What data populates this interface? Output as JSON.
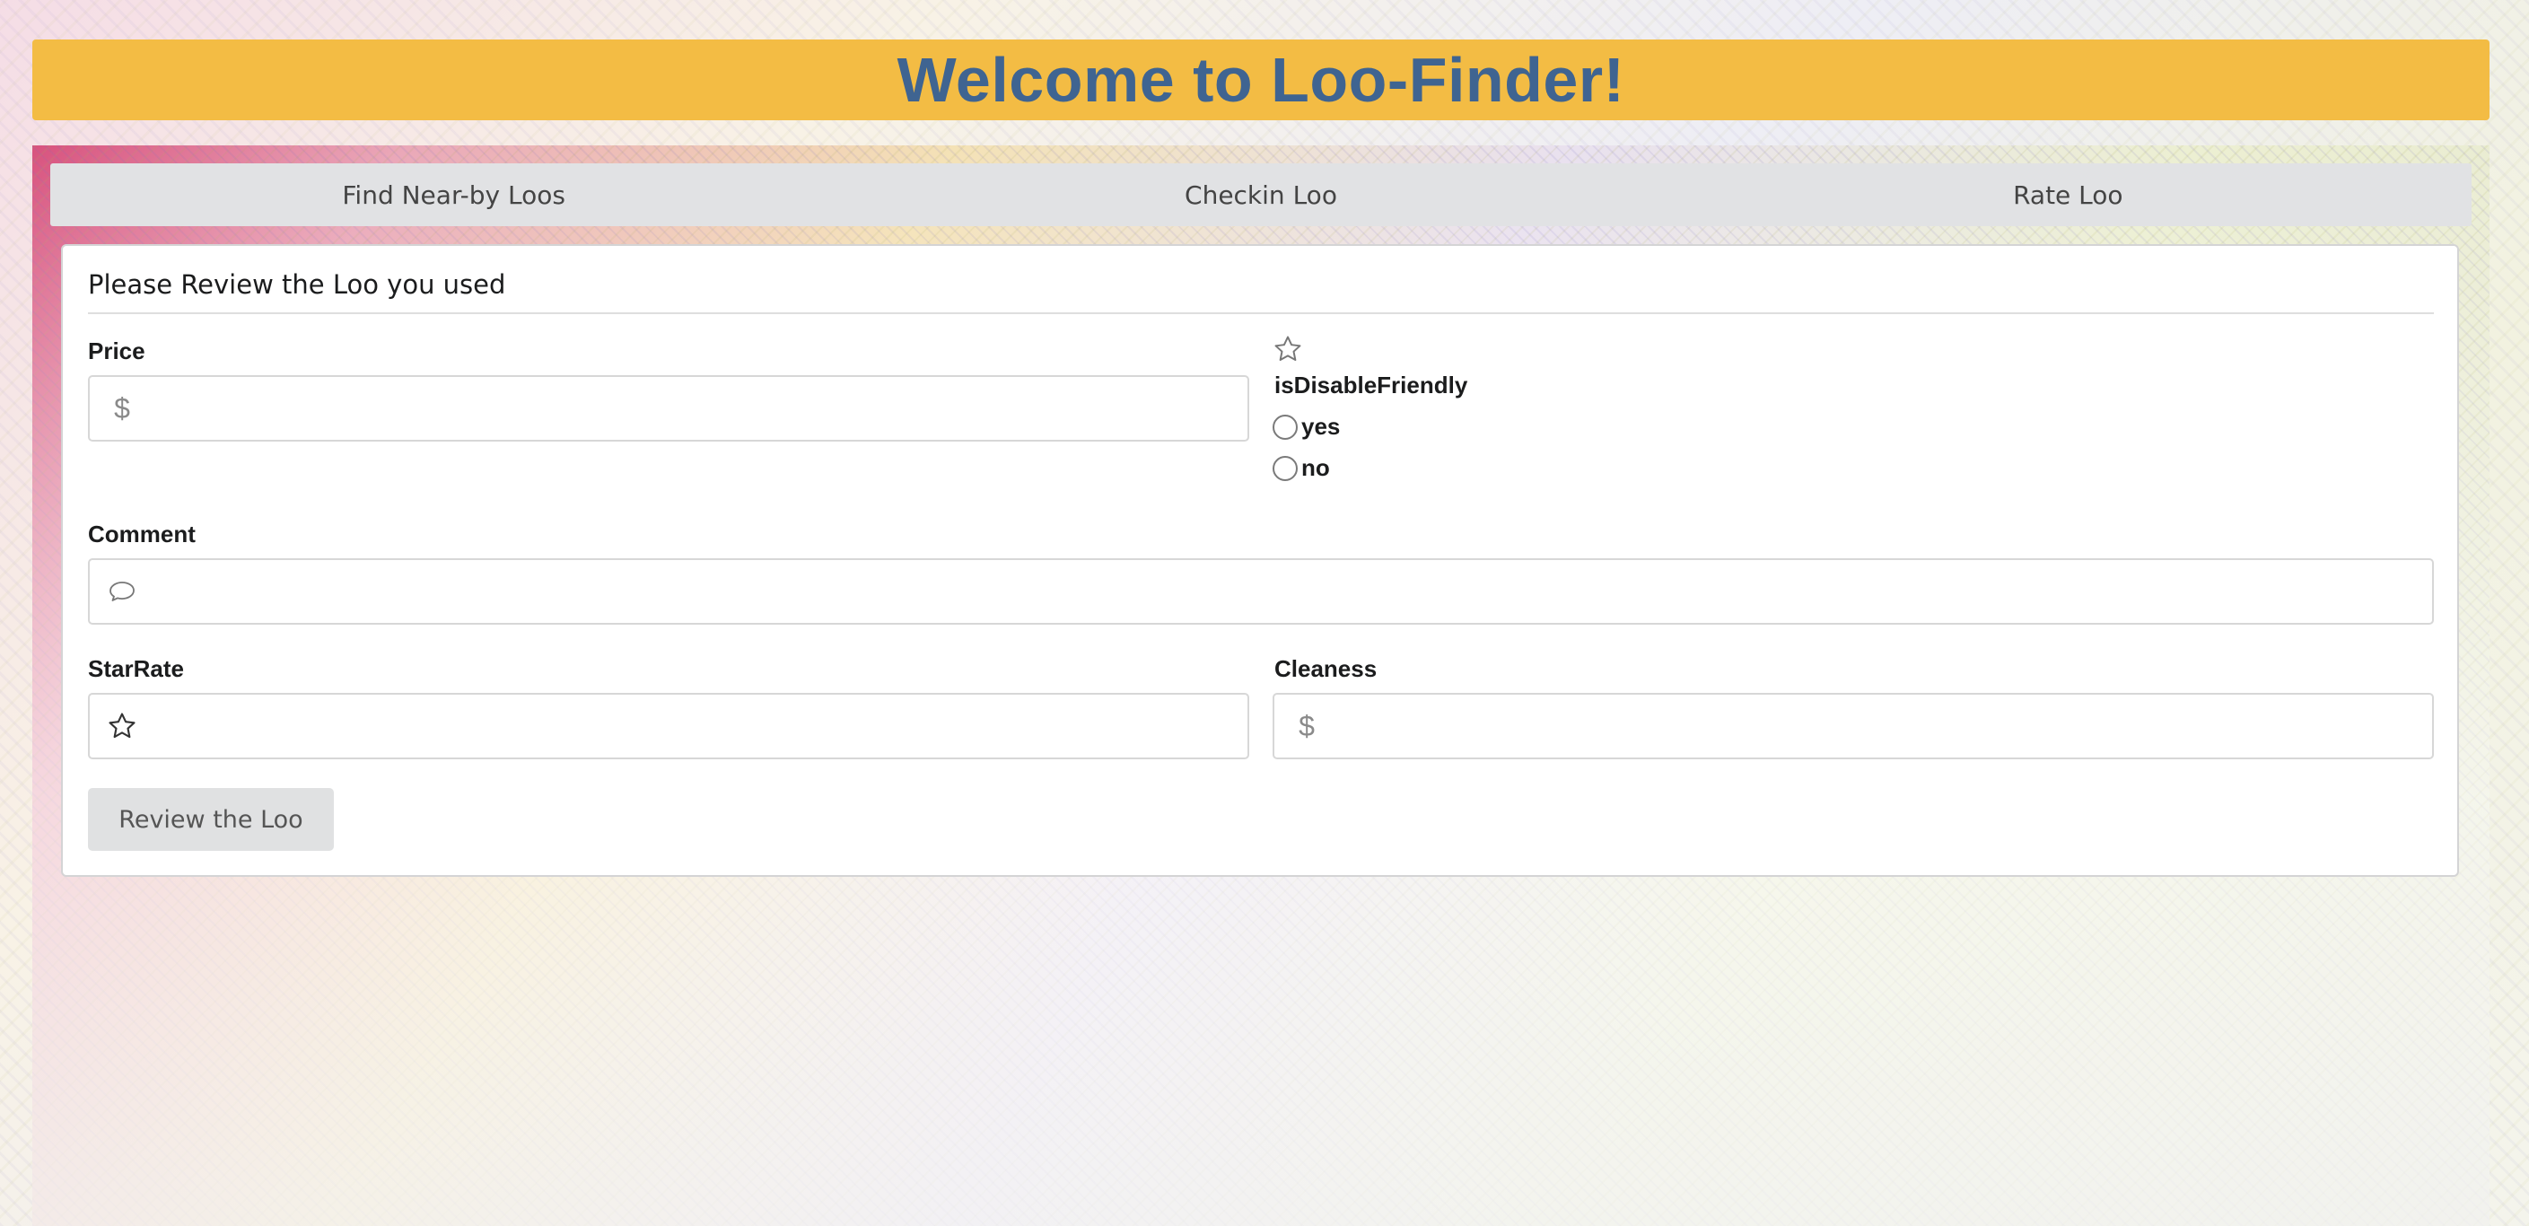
{
  "header": {
    "title": "Welcome to Loo-Finder!"
  },
  "tabs": [
    {
      "label": "Find Near-by Loos"
    },
    {
      "label": "Checkin Loo"
    },
    {
      "label": "Rate Loo"
    }
  ],
  "form": {
    "title": "Please Review the Loo you used",
    "price": {
      "label": "Price",
      "icon": "dollar-icon",
      "value": ""
    },
    "disable_friendly": {
      "icon": "star-icon",
      "label": "isDisableFriendly",
      "options": [
        "yes",
        "no"
      ],
      "selected": null
    },
    "comment": {
      "label": "Comment",
      "icon": "speech-bubble-icon",
      "value": ""
    },
    "star_rate": {
      "label": "StarRate",
      "icon": "star-icon",
      "value": ""
    },
    "cleaness": {
      "label": "Cleaness",
      "icon": "dollar-icon",
      "value": ""
    },
    "submit_label": "Review the Loo"
  },
  "colors": {
    "header_bg": "#f3bc44",
    "header_text": "#3f6491",
    "tab_bar": "#e1e2e4",
    "button_bg": "#e0e1e2"
  }
}
